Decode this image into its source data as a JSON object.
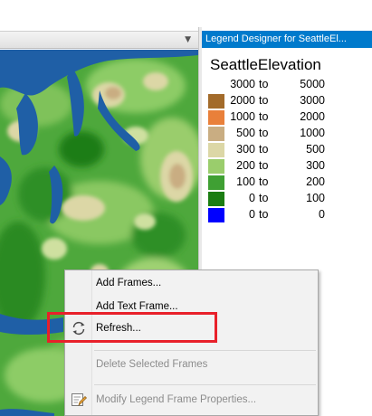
{
  "legend_panel": {
    "title": "Legend Designer for SeattleEl...",
    "legend_title": "SeattleElevation",
    "to_word": "to",
    "rows": [
      {
        "low": "3000",
        "high": "5000",
        "color": "#ffffff"
      },
      {
        "low": "2000",
        "high": "3000",
        "color": "#a36b2a"
      },
      {
        "low": "1000",
        "high": "2000",
        "color": "#e9803a"
      },
      {
        "low": "500",
        "high": "1000",
        "color": "#c9ad82"
      },
      {
        "low": "300",
        "high": "500",
        "color": "#dcd7a6"
      },
      {
        "low": "200",
        "high": "300",
        "color": "#9acd6c"
      },
      {
        "low": "100",
        "high": "200",
        "color": "#3fa033"
      },
      {
        "low": "0",
        "high": "100",
        "color": "#1b7d12"
      },
      {
        "low": "0",
        "high": "0",
        "color": "#0000ff"
      }
    ]
  },
  "context_menu": {
    "items": [
      {
        "label": "Add Frames...",
        "enabled": true
      },
      {
        "label": "Add Text Frame...",
        "enabled": true
      },
      {
        "label": "Refresh...",
        "enabled": true,
        "icon": "refresh-icon"
      },
      {
        "label": "Delete Selected Frames",
        "enabled": false
      },
      {
        "label": "Modify Legend Frame Properties...",
        "enabled": false,
        "icon": "edit-properties-icon"
      }
    ]
  },
  "colors": {
    "accent": "#007acc",
    "highlight": "#e8202a",
    "water": "#1f5fa6"
  }
}
